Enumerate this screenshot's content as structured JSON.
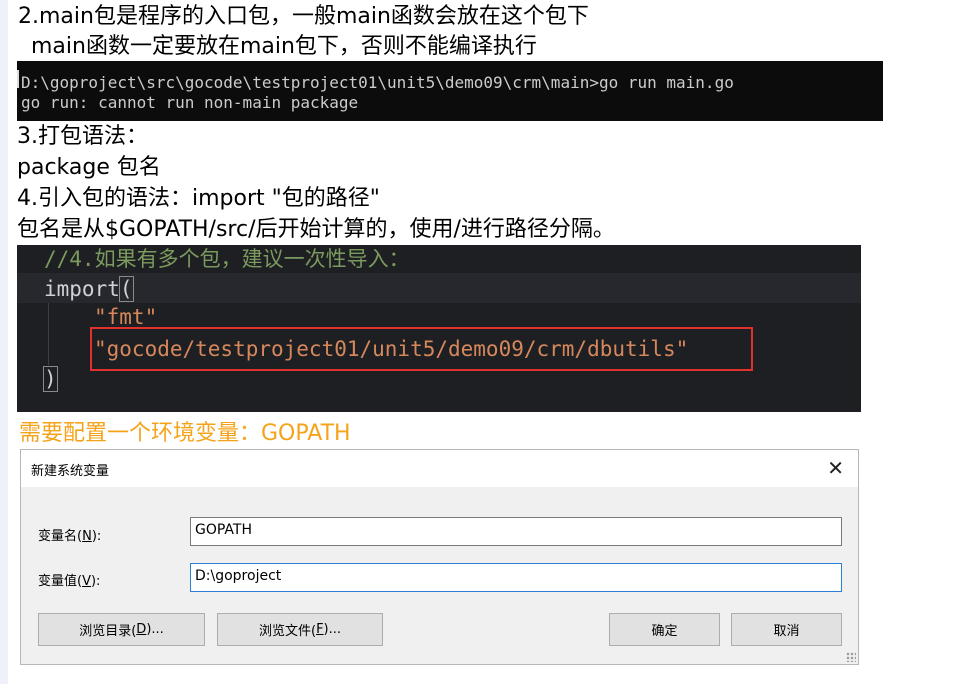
{
  "text": {
    "line1": "2.main包是程序的入口包，一般main函数会放在这个包下",
    "line2": "main函数一定要放在main包下，否则不能编译执行",
    "line3": "3.打包语法：",
    "line4": "package 包名",
    "line5": "4.引入包的语法：import \"包的路径\"",
    "line6": "包名是从$GOPATH/src/后开始计算的，使用/进行路径分隔。",
    "line7": "需要配置一个环境变量：GOPATH"
  },
  "terminal": {
    "line1": "D:\\goproject\\src\\gocode\\testproject01\\unit5\\demo09\\crm\\main>go run main.go",
    "line2": "go run: cannot run non-main package"
  },
  "code": {
    "comment": "//4.如果有多个包，建议一次性导入：",
    "import_kw": "import",
    "open_paren": "(",
    "pkg1": "\"fmt\"",
    "pkg2": "\"gocode/testproject01/unit5/demo09/crm/dbutils\"",
    "close_paren": ")"
  },
  "dialog": {
    "title": "新建系统变量",
    "close": "✕",
    "name_label_prefix": "变量名(",
    "name_label_key": "N",
    "name_label_suffix": "):",
    "value_label_prefix": "变量值(",
    "value_label_key": "V",
    "value_label_suffix": "):",
    "name_value": "GOPATH",
    "value_value": "D:\\goproject",
    "browse_dir_prefix": "浏览目录(",
    "browse_dir_key": "D",
    "browse_dir_suffix": ")...",
    "browse_file_prefix": "浏览文件(",
    "browse_file_key": "F",
    "browse_file_suffix": ")...",
    "ok": "确定",
    "cancel": "取消"
  },
  "colors": {
    "accent_orange": "#f5a31a",
    "highlight_red": "#e0312e",
    "focus_blue": "#2f7fd6"
  }
}
